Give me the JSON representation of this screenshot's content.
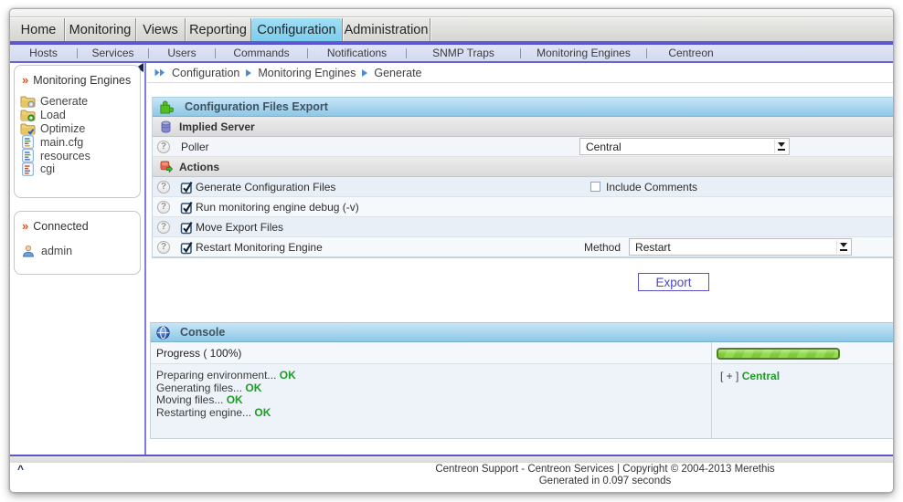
{
  "menubar": {
    "items": [
      {
        "label": "Home"
      },
      {
        "label": "Monitoring"
      },
      {
        "label": "Views"
      },
      {
        "label": "Reporting"
      },
      {
        "label": "Configuration",
        "active": true
      },
      {
        "label": "Administration"
      }
    ]
  },
  "subnav": {
    "items": [
      {
        "label": "Hosts"
      },
      {
        "label": "Services"
      },
      {
        "label": "Users"
      },
      {
        "label": "Commands"
      },
      {
        "label": "Notifications"
      },
      {
        "label": "SNMP Traps"
      },
      {
        "label": "Monitoring Engines"
      },
      {
        "label": "Centreon"
      }
    ]
  },
  "breadcrumb": {
    "items": [
      "Configuration",
      "Monitoring Engines",
      "Generate"
    ]
  },
  "sidebar": {
    "menu_title": "Monitoring Engines",
    "items": [
      {
        "label": "Generate",
        "icon": "folder-gear-icon"
      },
      {
        "label": "Load",
        "icon": "folder-plus-icon"
      },
      {
        "label": "Optimize",
        "icon": "folder-check-icon"
      },
      {
        "label": "main.cfg",
        "icon": "file-config-icon"
      },
      {
        "label": "resources",
        "icon": "file-resources-icon"
      },
      {
        "label": "cgi",
        "icon": "file-cgi-icon"
      }
    ],
    "connected_title": "Connected",
    "user": "admin"
  },
  "form": {
    "title": "Configuration Files Export",
    "section1": "Implied Server",
    "poller_label": "Poller",
    "poller_value": "Central",
    "section2": "Actions",
    "rows": [
      {
        "label": "Generate Configuration Files",
        "checked": true
      },
      {
        "label": "Run monitoring engine debug (-v)",
        "checked": true
      },
      {
        "label": "Move Export Files",
        "checked": true
      },
      {
        "label": "Restart Monitoring Engine",
        "checked": true
      }
    ],
    "include_comments_label": "Include Comments",
    "include_comments_checked": false,
    "method_label": "Method",
    "method_value": "Restart",
    "export_label": "Export"
  },
  "console": {
    "title": "Console",
    "progress_label": "Progress ( 100%)",
    "progress_percent": 100,
    "progress_color": "#7FCB37",
    "logs": [
      {
        "label": "Preparing environment...",
        "status": "OK"
      },
      {
        "label": "Generating files...",
        "status": "OK"
      },
      {
        "label": "Moving files...",
        "status": "OK"
      },
      {
        "label": "Restarting engine...",
        "status": "OK"
      }
    ],
    "host_prefix": "[ + ]",
    "host_name": "Central"
  },
  "footer": {
    "line1": "Centreon Support - Centreon Services | Copyright © 2004-2013 Merethis",
    "line2": "Generated in 0.097 seconds",
    "scroll_top": "^"
  },
  "colors": {
    "accent_purple": "#5751D3",
    "active_tab_cyan": "#7CCEEC",
    "header_blue_top": "#C8E6F5",
    "header_blue_bottom": "#8CC7E6",
    "ok_green": "#1F9C26",
    "progress_green": "#7FCB37"
  }
}
